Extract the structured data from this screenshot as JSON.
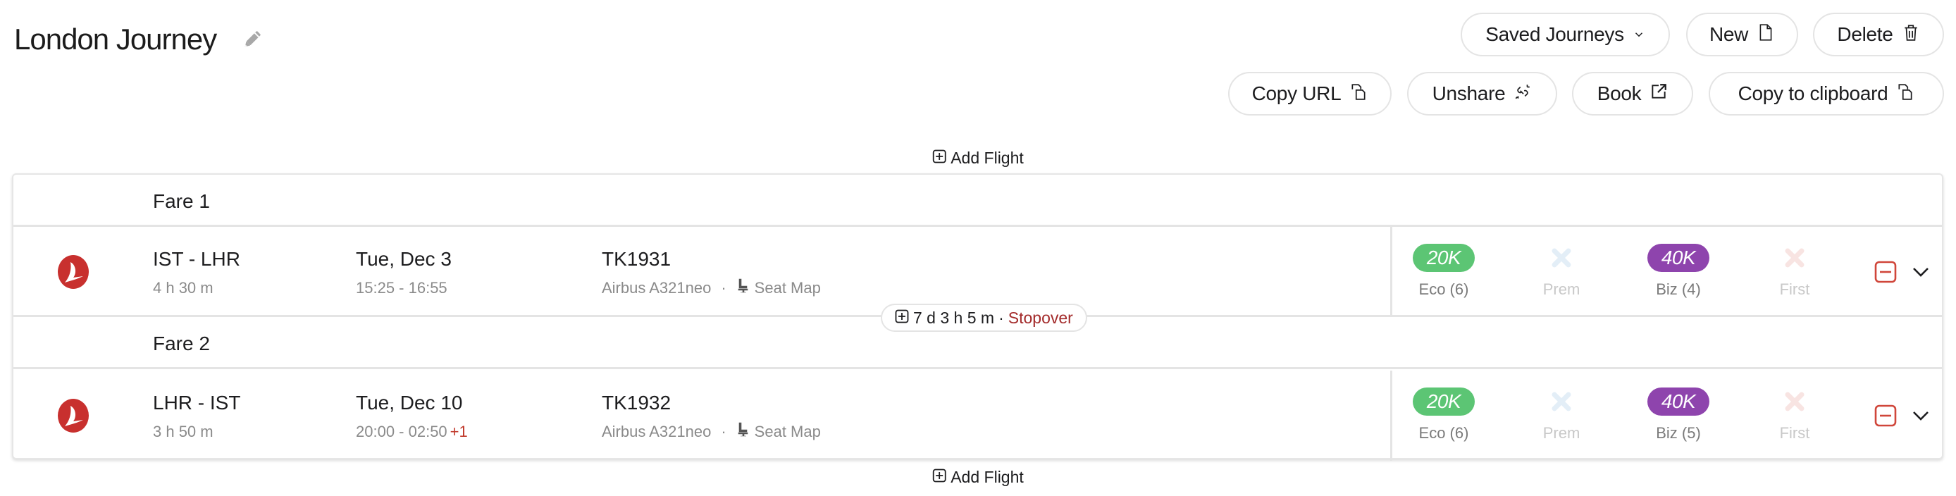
{
  "header": {
    "title": "London Journey",
    "edit_icon": "pencil-icon"
  },
  "toolbar": {
    "row1": [
      {
        "label": "Saved Journeys",
        "icon": "chevron-down-icon"
      },
      {
        "label": "New",
        "icon": "file-icon"
      },
      {
        "label": "Delete",
        "icon": "trash-icon"
      }
    ],
    "row2": [
      {
        "label": "Copy URL",
        "icon": "copy-icon"
      },
      {
        "label": "Unshare",
        "icon": "unlink-icon"
      },
      {
        "label": "Book",
        "icon": "external-link-icon"
      },
      {
        "label": "Copy to clipboard",
        "icon": "copy-icon"
      }
    ]
  },
  "add_flight_label": "Add Flight",
  "colors": {
    "eco_badge": "#5cc574",
    "biz_badge": "#8e44ad",
    "remove_red": "#d0463a",
    "stopover_red": "#a32a2a",
    "airline_red": "#c8302e"
  },
  "fares": [
    {
      "label": "Fare 1",
      "flight": {
        "airline_icon": "turkish-airlines-logo",
        "route": "IST - LHR",
        "duration": "4 h 30 m",
        "date": "Tue, Dec 3",
        "times": "15:25 - 16:55",
        "day_offset": "",
        "flight_number": "TK1931",
        "aircraft": "Airbus A321neo",
        "separator": "·",
        "seat_map_label": "Seat Map",
        "cabins": [
          {
            "name": "Eco (6)",
            "price": "20K",
            "available": true
          },
          {
            "name": "Prem",
            "price": "",
            "available": false
          },
          {
            "name": "Biz (4)",
            "price": "40K",
            "available": true
          },
          {
            "name": "First",
            "price": "",
            "available": false
          }
        ]
      }
    },
    {
      "label": "Fare 2",
      "flight": {
        "airline_icon": "turkish-airlines-logo",
        "route": "LHR - IST",
        "duration": "3 h 50 m",
        "date": "Tue, Dec 10",
        "times": "20:00 - 02:50",
        "day_offset": "+1",
        "flight_number": "TK1932",
        "aircraft": "Airbus A321neo",
        "separator": "·",
        "seat_map_label": "Seat Map",
        "cabins": [
          {
            "name": "Eco (6)",
            "price": "20K",
            "available": true
          },
          {
            "name": "Prem",
            "price": "",
            "available": false
          },
          {
            "name": "Biz (5)",
            "price": "40K",
            "available": true
          },
          {
            "name": "First",
            "price": "",
            "available": false
          }
        ]
      }
    }
  ],
  "stopover": {
    "duration": "7 d 3 h 5 m",
    "separator": "·",
    "label": "Stopover"
  }
}
